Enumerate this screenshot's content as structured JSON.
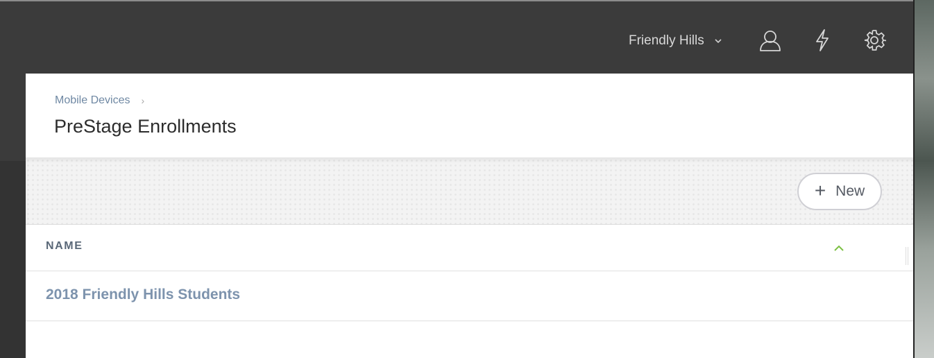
{
  "header": {
    "org_name": "Friendly Hills",
    "icons": [
      "user-icon",
      "lightning-icon",
      "gear-icon"
    ]
  },
  "breadcrumb": {
    "parent": "Mobile Devices",
    "separator": "›"
  },
  "page": {
    "title": "PreStage Enrollments"
  },
  "toolbar": {
    "new_button_label": "New",
    "new_button_icon": "+"
  },
  "table": {
    "columns": [
      {
        "label": "NAME",
        "sort": "ascending"
      }
    ],
    "rows": [
      {
        "name": "2018 Friendly Hills Students"
      }
    ]
  },
  "colors": {
    "accent_sort": "#7cc043",
    "link": "#7d93ad",
    "breadcrumb": "#6f88a3",
    "topbar": "#3b3b3b"
  }
}
